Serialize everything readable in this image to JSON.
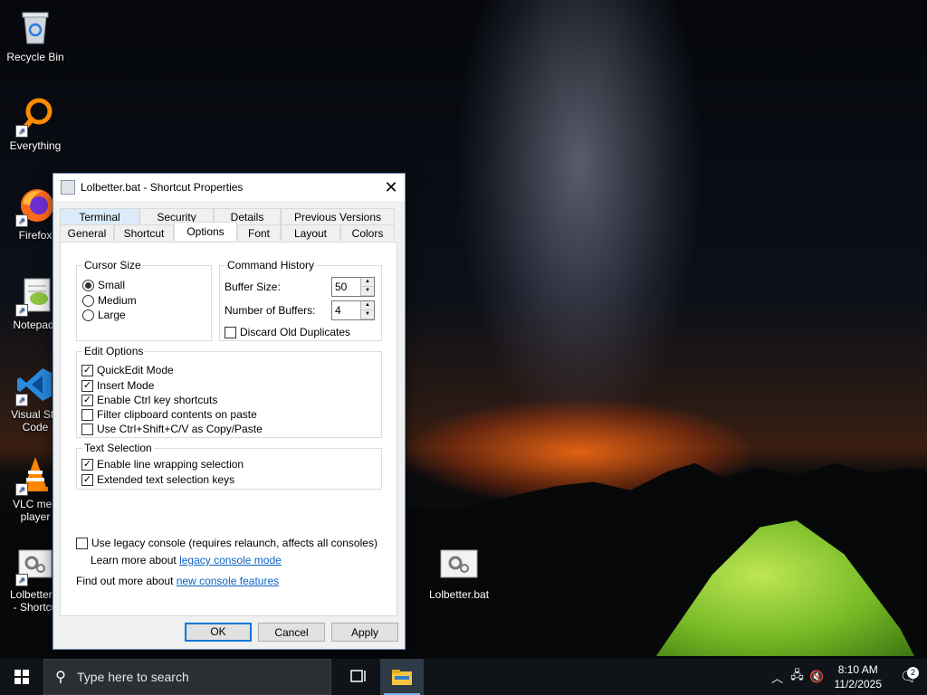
{
  "desktop": {
    "icons": [
      {
        "label": "Recycle Bin",
        "icon": "recycle-bin-icon"
      },
      {
        "label": "Everything",
        "icon": "everything-search-icon"
      },
      {
        "label": "Firefox",
        "icon": "firefox-icon"
      },
      {
        "label": "Notepad-",
        "icon": "notepad-plus-icon"
      },
      {
        "label": "Visual Stu\nCode",
        "icon": "vscode-icon"
      },
      {
        "label": "VLC med\nplayer",
        "icon": "vlc-icon"
      },
      {
        "label": "Lolbetter.b\n- Shortcu",
        "icon": "batch-file-icon"
      },
      {
        "label": "Lolbetter.bat",
        "icon": "batch-file-icon"
      }
    ]
  },
  "dialog": {
    "title": "Lolbetter.bat - Shortcut Properties",
    "tabs_top": [
      "Terminal",
      "Security",
      "Details",
      "Previous Versions"
    ],
    "tabs_bottom": [
      "General",
      "Shortcut",
      "Options",
      "Font",
      "Layout",
      "Colors"
    ],
    "active_tab": "Options",
    "cursor_size": {
      "legend": "Cursor Size",
      "options": [
        "Small",
        "Medium",
        "Large"
      ],
      "selected": "Small"
    },
    "command_history": {
      "legend": "Command History",
      "buffer_size_label": "Buffer Size:",
      "buffer_size": "50",
      "num_buffers_label": "Number of Buffers:",
      "num_buffers": "4",
      "discard_label": "Discard Old Duplicates",
      "discard_checked": false
    },
    "edit_options": {
      "legend": "Edit Options",
      "items": [
        {
          "label": "QuickEdit Mode",
          "checked": true
        },
        {
          "label": "Insert Mode",
          "checked": true
        },
        {
          "label": "Enable Ctrl key shortcuts",
          "checked": true
        },
        {
          "label": "Filter clipboard contents on paste",
          "checked": false
        },
        {
          "label": "Use Ctrl+Shift+C/V as Copy/Paste",
          "checked": false
        }
      ]
    },
    "text_selection": {
      "legend": "Text Selection",
      "items": [
        {
          "label": "Enable line wrapping selection",
          "checked": true
        },
        {
          "label": "Extended text selection keys",
          "checked": true
        }
      ]
    },
    "legacy": {
      "label": "Use legacy console (requires relaunch, affects all consoles)",
      "checked": false,
      "learn_prefix": "Learn more about ",
      "learn_link": "legacy console mode",
      "find_prefix": "Find out more about ",
      "find_link": "new console features"
    },
    "buttons": {
      "ok": "OK",
      "cancel": "Cancel",
      "apply": "Apply"
    }
  },
  "taskbar": {
    "search_placeholder": "Type here to search",
    "time": "8:10 AM",
    "date": "11/2/2025",
    "notification_count": "2"
  }
}
